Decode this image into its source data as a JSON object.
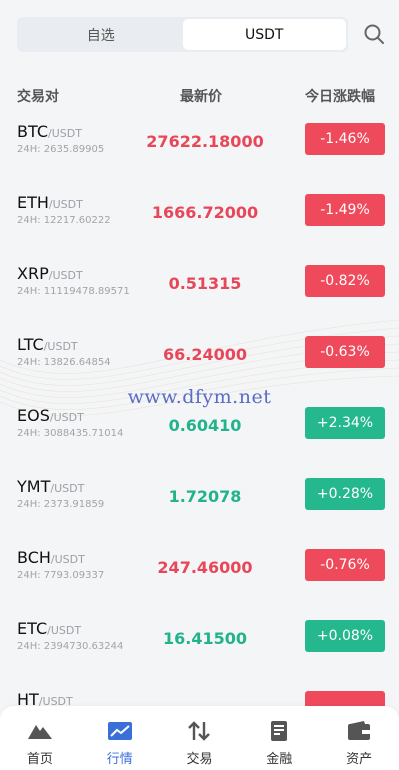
{
  "tabs": [
    {
      "label": "自选",
      "active": false
    },
    {
      "label": "USDT",
      "active": true
    }
  ],
  "search": {
    "icon": "search-icon"
  },
  "columns": {
    "pair": "交易对",
    "price": "最新价",
    "change": "今日涨跌幅"
  },
  "rows": [
    {
      "base": "BTC",
      "quote": "/USDT",
      "volume": "24H: 2635.89905",
      "price": "27622.18000",
      "change": "-1.46%",
      "direction": "down"
    },
    {
      "base": "ETH",
      "quote": "/USDT",
      "volume": "24H: 12217.60222",
      "price": "1666.72000",
      "change": "-1.49%",
      "direction": "down"
    },
    {
      "base": "XRP",
      "quote": "/USDT",
      "volume": "24H: 11119478.89571",
      "price": "0.51315",
      "change": "-0.82%",
      "direction": "down"
    },
    {
      "base": "LTC",
      "quote": "/USDT",
      "volume": "24H: 13826.64854",
      "price": "66.24000",
      "change": "-0.63%",
      "direction": "down"
    },
    {
      "base": "EOS",
      "quote": "/USDT",
      "volume": "24H: 3088435.71014",
      "price": "0.60410",
      "change": "+2.34%",
      "direction": "up"
    },
    {
      "base": "YMT",
      "quote": "/USDT",
      "volume": "24H: 2373.91859",
      "price": "1.72078",
      "change": "+0.28%",
      "direction": "up"
    },
    {
      "base": "BCH",
      "quote": "/USDT",
      "volume": "24H: 7793.09337",
      "price": "247.46000",
      "change": "-0.76%",
      "direction": "down"
    },
    {
      "base": "ETC",
      "quote": "/USDT",
      "volume": "24H: 2394730.63244",
      "price": "16.41500",
      "change": "+0.08%",
      "direction": "up"
    },
    {
      "base": "HT",
      "quote": "/USDT",
      "volume": "",
      "price": "",
      "change": "",
      "direction": "down"
    }
  ],
  "watermark": "www.dfym.net",
  "nav": [
    {
      "label": "首页",
      "icon": "home-mountain-icon",
      "active": false
    },
    {
      "label": "行情",
      "icon": "market-chart-icon",
      "active": true
    },
    {
      "label": "交易",
      "icon": "trade-arrows-icon",
      "active": false
    },
    {
      "label": "金融",
      "icon": "finance-doc-icon",
      "active": false
    },
    {
      "label": "资产",
      "icon": "wallet-icon",
      "active": false
    }
  ],
  "colors": {
    "up": "#25b88f",
    "down": "#ef4a5c",
    "accent": "#3b6fd8"
  }
}
